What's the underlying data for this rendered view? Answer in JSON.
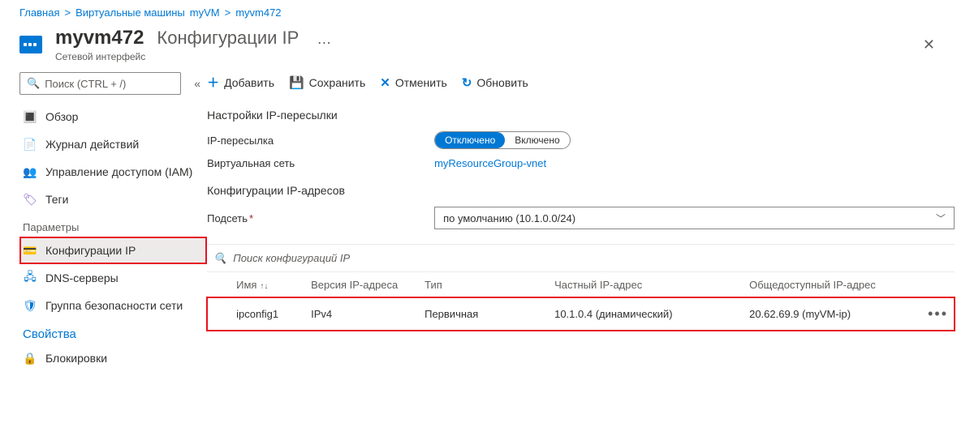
{
  "breadcrumb": {
    "home": "Главная",
    "sep": ">",
    "vms": "Виртуальные машины",
    "vm": "myVM",
    "nic": "myvm472"
  },
  "header": {
    "name": "myvm472",
    "blade": "Конфигурации IP",
    "subtitle": "Сетевой интерфейс"
  },
  "sidebar": {
    "search_placeholder": "Поиск (CTRL + /)",
    "items": {
      "overview": "Обзор",
      "activity": "Журнал действий",
      "iam": "Управление доступом (IAM)",
      "tags": "Теги"
    },
    "section_params": "Параметры",
    "params": {
      "ipconfig": "Конфигурации IP",
      "dns": "DNS-серверы",
      "nsg": "Группа безопасности сети"
    },
    "section_props": "Свойства",
    "props": {
      "locks": "Блокировки"
    }
  },
  "toolbar": {
    "add": "Добавить",
    "save": "Сохранить",
    "discard": "Отменить",
    "refresh": "Обновить"
  },
  "form": {
    "section": "Настройки IP-пересылки",
    "fwd_label": "IP-пересылка",
    "fwd_off": "Отключено",
    "fwd_on": "Включено",
    "vnet_label": "Виртуальная сеть",
    "vnet_value": "myResourceGroup-vnet",
    "ipaddr_section": "Конфигурации IP-адресов",
    "subnet_label": "Подсеть",
    "subnet_value": "по умолчанию (10.1.0.0/24)"
  },
  "table": {
    "filter_placeholder": "Поиск конфигураций IP",
    "cols": {
      "name": "Имя",
      "ver": "Версия IP-адреса",
      "type": "Тип",
      "priv": "Частный IP-адрес",
      "pub": "Общедоступный IP-адрес"
    },
    "rows": [
      {
        "name": "ipconfig1",
        "ver": "IPv4",
        "type": "Первичная",
        "priv": "10.1.0.4 (динамический)",
        "pub": "20.62.69.9 (myVM-ip)"
      }
    ]
  }
}
